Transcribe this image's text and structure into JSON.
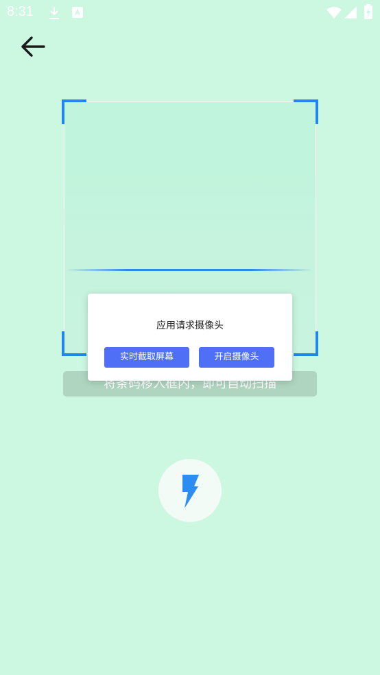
{
  "status_bar": {
    "time": "8:31",
    "icons": [
      "download-icon",
      "a-badge-icon",
      "wifi-icon",
      "signal-icon",
      "battery-icon"
    ]
  },
  "header": {
    "back_icon": "arrow-left-icon"
  },
  "scanner": {
    "hint": "将条码移入框内，即可自动扫描",
    "corner_color": "#1f86f0",
    "line_color": "#2f86e8"
  },
  "dialog": {
    "title": "应用请求摄像头",
    "screen_capture_button": "实时截取屏幕",
    "open_camera_button": "开启摄像头",
    "button_color": "#4f70f6"
  },
  "flash": {
    "icon": "lightning-icon",
    "color": "#2b8cf2"
  },
  "colors": {
    "background": "#ccf7e1"
  }
}
